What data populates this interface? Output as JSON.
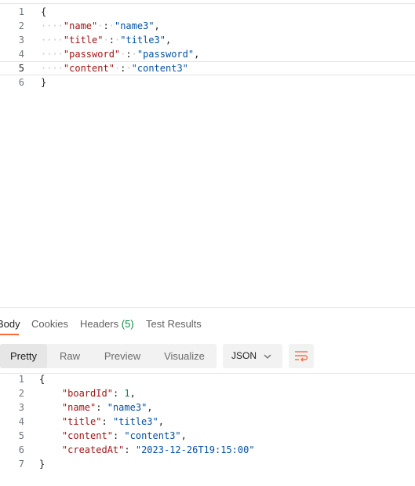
{
  "request_body": {
    "lines": [
      {
        "n": "1",
        "parts": [
          {
            "t": "{",
            "c": "brace"
          }
        ]
      },
      {
        "n": "2",
        "parts": [
          {
            "t": "····",
            "c": "dots"
          },
          {
            "t": "\"name\"",
            "c": "key"
          },
          {
            "t": "·",
            "c": "dots"
          },
          {
            "t": ":",
            "c": "pun"
          },
          {
            "t": "·",
            "c": "dots"
          },
          {
            "t": "\"name3\"",
            "c": "str"
          },
          {
            "t": ",",
            "c": "pun"
          }
        ]
      },
      {
        "n": "3",
        "parts": [
          {
            "t": "····",
            "c": "dots"
          },
          {
            "t": "\"title\"",
            "c": "key"
          },
          {
            "t": "·",
            "c": "dots"
          },
          {
            "t": ":",
            "c": "pun"
          },
          {
            "t": "·",
            "c": "dots"
          },
          {
            "t": "\"title3\"",
            "c": "str"
          },
          {
            "t": ",",
            "c": "pun"
          }
        ]
      },
      {
        "n": "4",
        "parts": [
          {
            "t": "····",
            "c": "dots"
          },
          {
            "t": "\"password\"",
            "c": "key"
          },
          {
            "t": "·",
            "c": "dots"
          },
          {
            "t": ":",
            "c": "pun"
          },
          {
            "t": "·",
            "c": "dots"
          },
          {
            "t": "\"password\"",
            "c": "str"
          },
          {
            "t": ",",
            "c": "pun"
          }
        ]
      },
      {
        "n": "5",
        "parts": [
          {
            "t": "····",
            "c": "dots"
          },
          {
            "t": "\"content\"",
            "c": "key"
          },
          {
            "t": "·",
            "c": "dots"
          },
          {
            "t": ":",
            "c": "pun"
          },
          {
            "t": "·",
            "c": "dots"
          },
          {
            "t": "\"content3\"",
            "c": "str"
          }
        ],
        "active": true
      },
      {
        "n": "6",
        "parts": [
          {
            "t": "}",
            "c": "brace"
          }
        ]
      }
    ]
  },
  "response": {
    "tabs": [
      {
        "label": "Body",
        "active": true
      },
      {
        "label": "Cookies"
      },
      {
        "label": "Headers",
        "count": "(5)"
      },
      {
        "label": "Test Results"
      }
    ],
    "view_modes": [
      "Pretty",
      "Raw",
      "Preview",
      "Visualize"
    ],
    "active_view": "Pretty",
    "format_select": "JSON",
    "body_lines": [
      {
        "n": "1",
        "parts": [
          {
            "t": "{",
            "c": "brace"
          }
        ]
      },
      {
        "n": "2",
        "parts": [
          {
            "t": "    ",
            "c": "pun"
          },
          {
            "t": "\"boardId\"",
            "c": "key"
          },
          {
            "t": ": ",
            "c": "pun"
          },
          {
            "t": "1",
            "c": "num"
          },
          {
            "t": ",",
            "c": "pun"
          }
        ]
      },
      {
        "n": "3",
        "parts": [
          {
            "t": "    ",
            "c": "pun"
          },
          {
            "t": "\"name\"",
            "c": "key"
          },
          {
            "t": ": ",
            "c": "pun"
          },
          {
            "t": "\"name3\"",
            "c": "str"
          },
          {
            "t": ",",
            "c": "pun"
          }
        ]
      },
      {
        "n": "4",
        "parts": [
          {
            "t": "    ",
            "c": "pun"
          },
          {
            "t": "\"title\"",
            "c": "key"
          },
          {
            "t": ": ",
            "c": "pun"
          },
          {
            "t": "\"title3\"",
            "c": "str"
          },
          {
            "t": ",",
            "c": "pun"
          }
        ]
      },
      {
        "n": "5",
        "parts": [
          {
            "t": "    ",
            "c": "pun"
          },
          {
            "t": "\"content\"",
            "c": "key"
          },
          {
            "t": ": ",
            "c": "pun"
          },
          {
            "t": "\"content3\"",
            "c": "str"
          },
          {
            "t": ",",
            "c": "pun"
          }
        ]
      },
      {
        "n": "6",
        "parts": [
          {
            "t": "    ",
            "c": "pun"
          },
          {
            "t": "\"createdAt\"",
            "c": "key"
          },
          {
            "t": ": ",
            "c": "pun"
          },
          {
            "t": "\"2023-12-26T19:15:00\"",
            "c": "str"
          }
        ]
      },
      {
        "n": "7",
        "parts": [
          {
            "t": "}",
            "c": "brace"
          }
        ]
      }
    ]
  },
  "icons": {
    "chevron": "chevron-down-icon",
    "wrap": "wrap-lines-icon"
  },
  "colors": {
    "accent": "#ff6c37",
    "count": "#0b8a41",
    "key": "#a31515",
    "string": "#0451a5",
    "number": "#098658"
  }
}
